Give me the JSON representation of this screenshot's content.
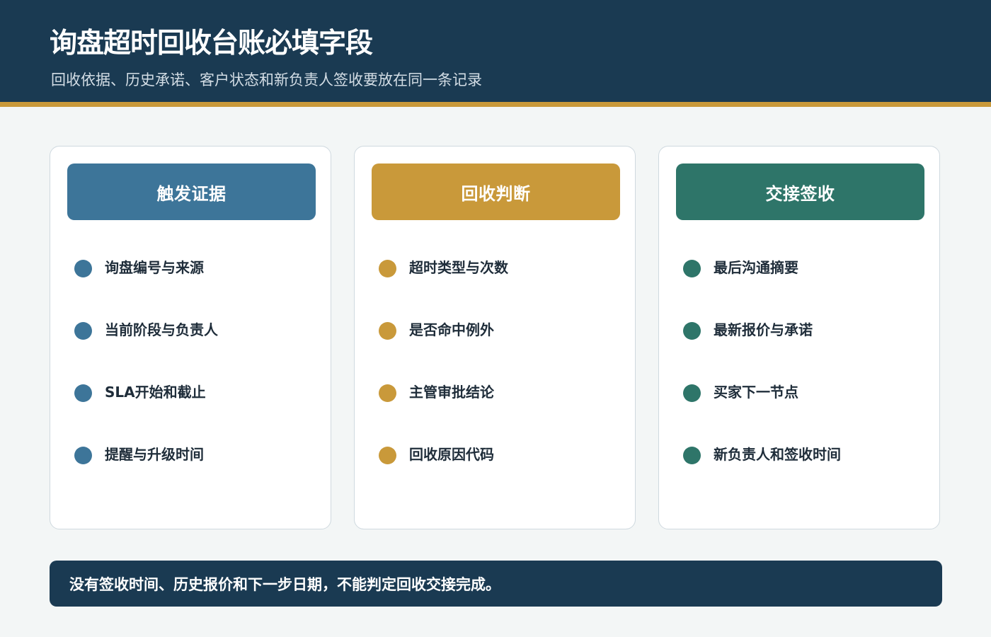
{
  "header": {
    "title": "询盘超时回收台账必填字段",
    "subtitle": "回收依据、历史承诺、客户状态和新负责人签收要放在同一条记录"
  },
  "colors": {
    "header_bg": "#1a3a52",
    "accent_rule": "#c9993a",
    "blue": "#3d7599",
    "gold": "#c9993a",
    "teal": "#2e7569"
  },
  "cards": [
    {
      "title": "触发证据",
      "color": "#3d7599",
      "items": [
        "询盘编号与来源",
        "当前阶段与负责人",
        "SLA开始和截止",
        "提醒与升级时间"
      ]
    },
    {
      "title": "回收判断",
      "color": "#c9993a",
      "items": [
        "超时类型与次数",
        "是否命中例外",
        "主管审批结论",
        "回收原因代码"
      ]
    },
    {
      "title": "交接签收",
      "color": "#2e7569",
      "items": [
        "最后沟通摘要",
        "最新报价与承诺",
        "买家下一节点",
        "新负责人和签收时间"
      ]
    }
  ],
  "footer": {
    "text": "没有签收时间、历史报价和下一步日期，不能判定回收交接完成。"
  }
}
